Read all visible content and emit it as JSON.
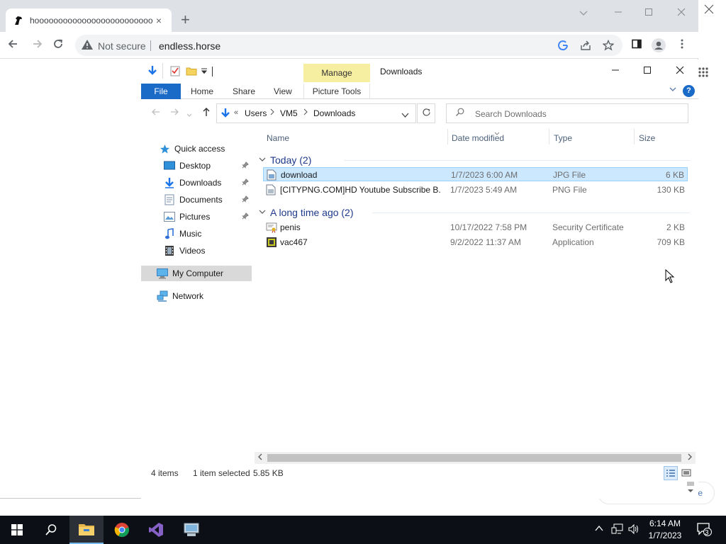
{
  "browser": {
    "tab_title": "hoooooooooooooooooooooooooooooooooo",
    "tab_close": "×",
    "new_tab": "+",
    "not_secure": "Not secure",
    "url": "endless.horse",
    "right_card_text": "e"
  },
  "explorer": {
    "manage_label": "Manage",
    "title": "Downloads",
    "ribbon": {
      "file": "File",
      "home": "Home",
      "share": "Share",
      "view": "View",
      "picture_tools": "Picture Tools",
      "help": "?"
    },
    "address": {
      "overflow": "«",
      "crumbs": [
        "Users",
        "VM5",
        "Downloads"
      ],
      "search_placeholder": "Search Downloads"
    },
    "nav": {
      "quick_access": "Quick access",
      "desktop": "Desktop",
      "downloads": "Downloads",
      "documents": "Documents",
      "pictures": "Pictures",
      "music": "Music",
      "videos": "Videos",
      "my_computer": "My Computer",
      "network": "Network"
    },
    "columns": {
      "name": "Name",
      "date": "Date modified",
      "type": "Type",
      "size": "Size"
    },
    "groups": [
      {
        "title": "Today (2)",
        "files": [
          {
            "name": "download",
            "date": "1/7/2023 6:00 AM",
            "type": "JPG File",
            "size": "6 KB"
          },
          {
            "name": "[CITYPNG.COM]HD Youtube Subscribe B...",
            "date": "1/7/2023 5:49 AM",
            "type": "PNG File",
            "size": "130 KB"
          }
        ]
      },
      {
        "title": "A long time ago (2)",
        "files": [
          {
            "name": "penis",
            "date": "10/17/2022 7:58 PM",
            "type": "Security Certificate",
            "size": "2 KB"
          },
          {
            "name": "vac467",
            "date": "9/2/2022 11:37 AM",
            "type": "Application",
            "size": "709 KB"
          }
        ]
      }
    ],
    "status": {
      "items": "4 items",
      "selected": "1 item selected",
      "size": "5.85 KB"
    }
  },
  "taskbar": {
    "time": "6:14 AM",
    "date": "1/7/2023",
    "notifications": "3"
  },
  "colors": {
    "file_tab": "#1a6ac8",
    "manage_tab": "#f6eea0",
    "selection": "#cce8ff",
    "taskbar": "#0c1016"
  }
}
